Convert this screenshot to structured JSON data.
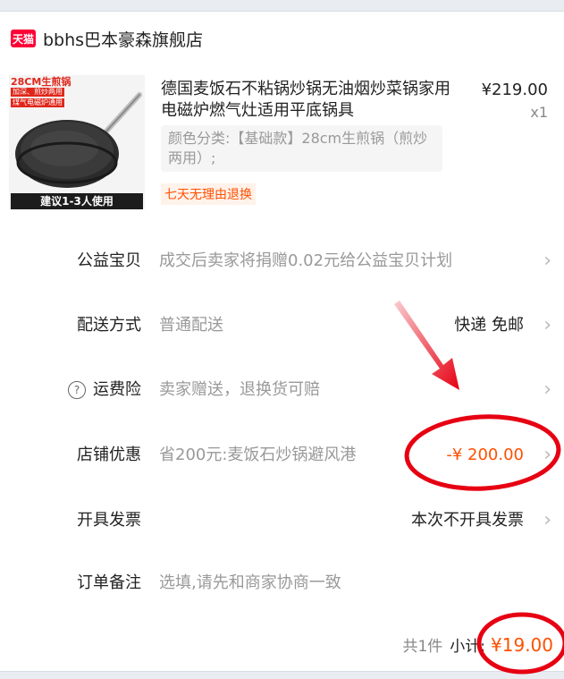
{
  "shop": {
    "badge": "天猫",
    "name": "bbhs巴本豪森旗舰店"
  },
  "product": {
    "thumb_tag": "28CM生煎锅",
    "thumb_sub1": "加深、煎炒两用",
    "thumb_sub2": "煤气电磁炉通用",
    "thumb_caption": "建议1-3人使用",
    "title": "德国麦饭石不粘锅炒锅无油烟炒菜锅家用电磁炉燃气灶适用平底锅具",
    "price": "¥219.00",
    "quantity": "x1",
    "spec": "颜色分类:【基础款】28cm生煎锅（煎炒两用）;",
    "promise": "七天无理由退换"
  },
  "rows": {
    "charity": {
      "label": "公益宝贝",
      "value": "成交后卖家将捐赠0.02元给公益宝贝计划"
    },
    "delivery": {
      "label": "配送方式",
      "value": "普通配送",
      "right": "快递 免邮"
    },
    "insurance": {
      "icon": "?",
      "label": "运费险",
      "value": "卖家赠送，退换货可赔"
    },
    "discount": {
      "label": "店铺优惠",
      "value": "省200元:麦饭石炒锅避风港",
      "right": "-¥ 200.00"
    },
    "invoice": {
      "label": "开具发票",
      "right": "本次不开具发票"
    },
    "note": {
      "label": "订单备注",
      "value": "选填,请先和商家协商一致"
    }
  },
  "summary": {
    "count": "共1件",
    "label": "小计:",
    "amount": "¥19.00"
  },
  "colors": {
    "accent": "#ff5000",
    "annotation": "#e60012",
    "tmall": "#ff0036"
  },
  "icons": {
    "chevron": "chevron-right-icon",
    "help": "question-circle-icon"
  }
}
